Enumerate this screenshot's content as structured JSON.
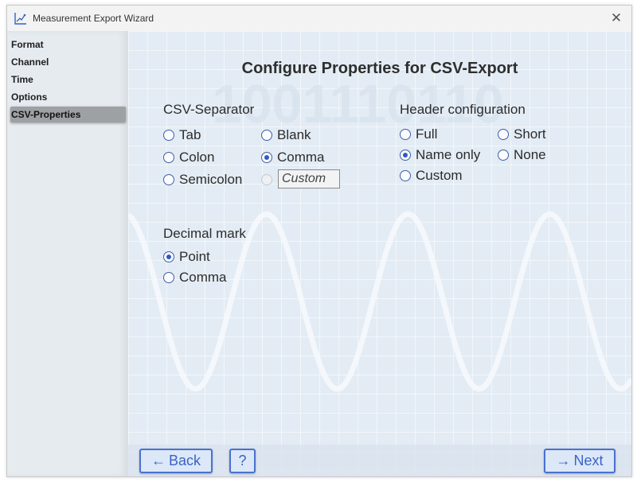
{
  "window": {
    "title": "Measurement Export Wizard",
    "app_icon": "chart-wand-icon",
    "close_icon": "close-icon",
    "close_glyph": "✕"
  },
  "sidebar": {
    "items": [
      {
        "label": "Format",
        "active": false
      },
      {
        "label": "Channel",
        "active": false
      },
      {
        "label": "Time",
        "active": false
      },
      {
        "label": "Options",
        "active": false
      },
      {
        "label": "CSV-Properties",
        "active": true
      }
    ]
  },
  "main": {
    "heading": "Configure Properties for CSV-Export",
    "separator": {
      "label": "CSV-Separator",
      "options": {
        "tab": {
          "label": "Tab",
          "checked": false
        },
        "blank": {
          "label": "Blank",
          "checked": false
        },
        "colon": {
          "label": "Colon",
          "checked": false
        },
        "comma": {
          "label": "Comma",
          "checked": true
        },
        "semicolon": {
          "label": "Semicolon",
          "checked": false
        },
        "custom": {
          "label": "",
          "checked": false,
          "disabled": true
        }
      },
      "custom_value": "Custom"
    },
    "header": {
      "label": "Header configuration",
      "options": {
        "full": {
          "label": "Full",
          "checked": false
        },
        "short": {
          "label": "Short",
          "checked": false
        },
        "name_only": {
          "label": "Name only",
          "checked": true
        },
        "none": {
          "label": "None",
          "checked": false
        },
        "custom": {
          "label": "Custom",
          "checked": false
        }
      }
    },
    "decimal": {
      "label": "Decimal mark",
      "options": {
        "point": {
          "label": "Point",
          "checked": true
        },
        "comma": {
          "label": "Comma",
          "checked": false
        }
      }
    }
  },
  "footer": {
    "back_label": "Back",
    "back_arrow": "←",
    "help_label": "?",
    "next_label": "Next",
    "next_arrow": "→"
  },
  "colors": {
    "accent": "#3059c5",
    "button_border": "#4a72d1",
    "content_bg": "#e3ecf4",
    "sidebar_bg": "#e6ebf0"
  }
}
